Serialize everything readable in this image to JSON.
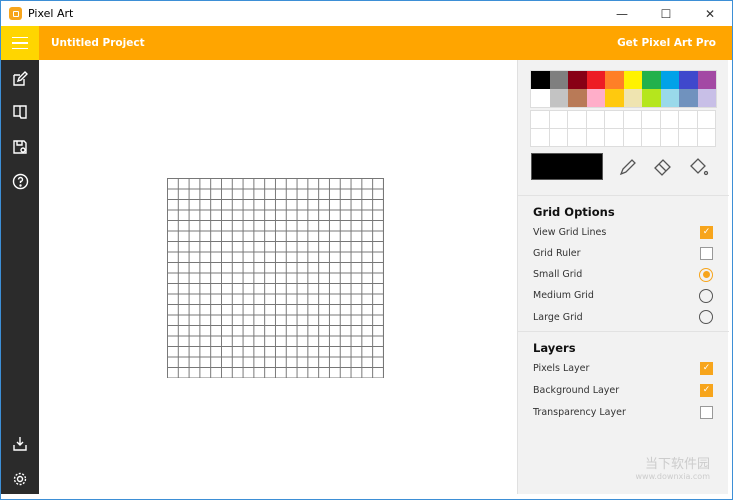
{
  "window": {
    "title": "Pixel Art",
    "minimize": "—",
    "maximize": "☐",
    "close": "✕"
  },
  "header": {
    "project": "Untitled Project",
    "pro": "Get Pixel Art Pro"
  },
  "sidebar": {
    "icons": [
      "edit-icon",
      "open-book-icon",
      "save-icon",
      "help-icon",
      "download-icon",
      "settings-icon"
    ]
  },
  "palette": {
    "colors": [
      "#000000",
      "#7f7f7f",
      "#880015",
      "#ed1c24",
      "#ff7f27",
      "#fff200",
      "#22b14c",
      "#00a2e8",
      "#3f48cc",
      "#a349a4",
      "#ffffff",
      "#c3c3c3",
      "#b97a57",
      "#ffaec9",
      "#ffc90e",
      "#efe4b0",
      "#b5e61d",
      "#99d9ea",
      "#7092be",
      "#c8bfe7"
    ],
    "current_color": "#000000",
    "accent": "#f7a51c"
  },
  "grid_options": {
    "title": "Grid Options",
    "items": [
      {
        "label": "View Grid Lines",
        "type": "checkbox",
        "checked": true
      },
      {
        "label": "Grid Ruler",
        "type": "checkbox",
        "checked": false
      },
      {
        "label": "Small Grid",
        "type": "radio",
        "checked": true
      },
      {
        "label": "Medium Grid",
        "type": "radio",
        "checked": false
      },
      {
        "label": "Large Grid",
        "type": "radio",
        "checked": false
      }
    ]
  },
  "layers": {
    "title": "Layers",
    "items": [
      {
        "label": "Pixels Layer",
        "checked": true
      },
      {
        "label": "Background Layer",
        "checked": true
      },
      {
        "label": "Transparency Layer",
        "checked": false
      }
    ]
  },
  "watermark": {
    "name": "当下软件园",
    "url": "www.downxia.com"
  }
}
